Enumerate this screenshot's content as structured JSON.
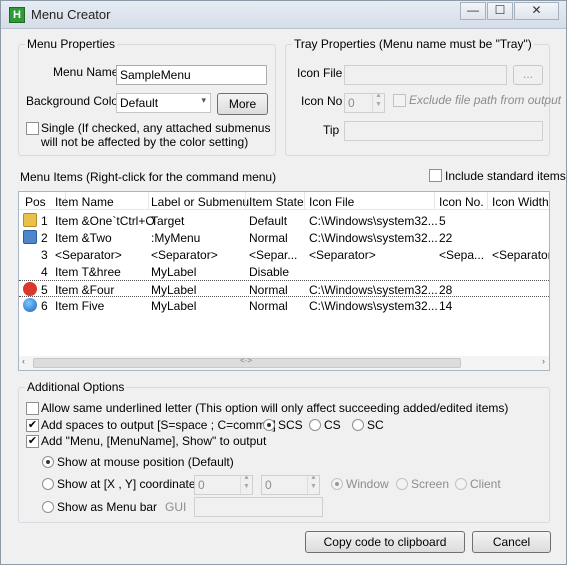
{
  "window": {
    "title": "Menu Creator",
    "minimize": "—",
    "maximize": "☐",
    "close": "✕",
    "app_icon_letter": "H",
    "app_icon_color": "#2f9a3a"
  },
  "menu_properties": {
    "title": "Menu Properties",
    "menu_name_label": "Menu Name",
    "menu_name_value": "SampleMenu",
    "background_color_label": "Background Color",
    "background_color_value": "Default",
    "more_button": "More",
    "single_label": "Single (If checked, any attached submenus will not be affected by the color setting)"
  },
  "tray_properties": {
    "title": "Tray Properties (Menu name must be \"Tray\")",
    "icon_file_label": "Icon File",
    "browse_button": "...",
    "icon_no_label": "Icon No",
    "icon_no_value": "0",
    "exclude_label": "Exclude file path from output",
    "tip_label": "Tip"
  },
  "menu_items": {
    "title": "Menu Items (Right-click for the command menu)",
    "include_standard_label": "Include standard items",
    "columns": [
      "Pos",
      "Item Name",
      "Label or Submenu",
      "Item State",
      "Icon File",
      "Icon No.",
      "Icon Width"
    ],
    "rows": [
      {
        "icon": "folder-icon",
        "pos": "1",
        "name": "Item &One`tCtrl+O",
        "label": "Target",
        "state": "Default",
        "file": "C:\\Windows\\system32...",
        "no": "5",
        "width": ""
      },
      {
        "icon": "id-card-icon",
        "pos": "2",
        "name": "Item &Two",
        "label": ":MyMenu",
        "state": "Normal",
        "file": "C:\\Windows\\system32...",
        "no": "22",
        "width": ""
      },
      {
        "icon": "",
        "pos": "3",
        "name": "<Separator>",
        "label": "<Separator>",
        "state": "<Separ...",
        "file": "<Separator>",
        "no": "<Sepa...",
        "width": "<Separator>"
      },
      {
        "icon": "",
        "pos": "4",
        "name": "Item T&hree",
        "label": "MyLabel",
        "state": "Disable",
        "file": "",
        "no": "",
        "width": ""
      },
      {
        "icon": "power-icon",
        "pos": "5",
        "name": "Item &Four",
        "label": "MyLabel",
        "state": "Normal",
        "file": "C:\\Windows\\system32...",
        "no": "28",
        "width": ""
      },
      {
        "icon": "globe-icon",
        "pos": "6",
        "name": "Item Five",
        "label": "MyLabel",
        "state": "Normal",
        "file": "C:\\Windows\\system32...",
        "no": "14",
        "width": ""
      }
    ],
    "scroll_center": "<·>"
  },
  "additional_options": {
    "title": "Additional Options",
    "allow_same_underlined": "Allow same underlined letter (This option will only affect succeeding added/edited items)",
    "add_spaces": "Add spaces to output [S=space ; C=comma]",
    "radio_scs": "SCS",
    "radio_cs": "CS",
    "radio_sc": "SC",
    "add_menu_output": "Add \"Menu, [MenuName], Show\" to output",
    "show_mouse": "Show at mouse position (Default)",
    "show_xy": "Show at [X , Y] coordinates",
    "x_value": "0",
    "y_value": "0",
    "radio_window": "Window",
    "radio_screen": "Screen",
    "radio_client": "Client",
    "show_menubar": "Show as Menu bar",
    "gui_label": "GUI"
  },
  "footer": {
    "copy_button": "Copy code to clipboard",
    "cancel_button": "Cancel"
  }
}
